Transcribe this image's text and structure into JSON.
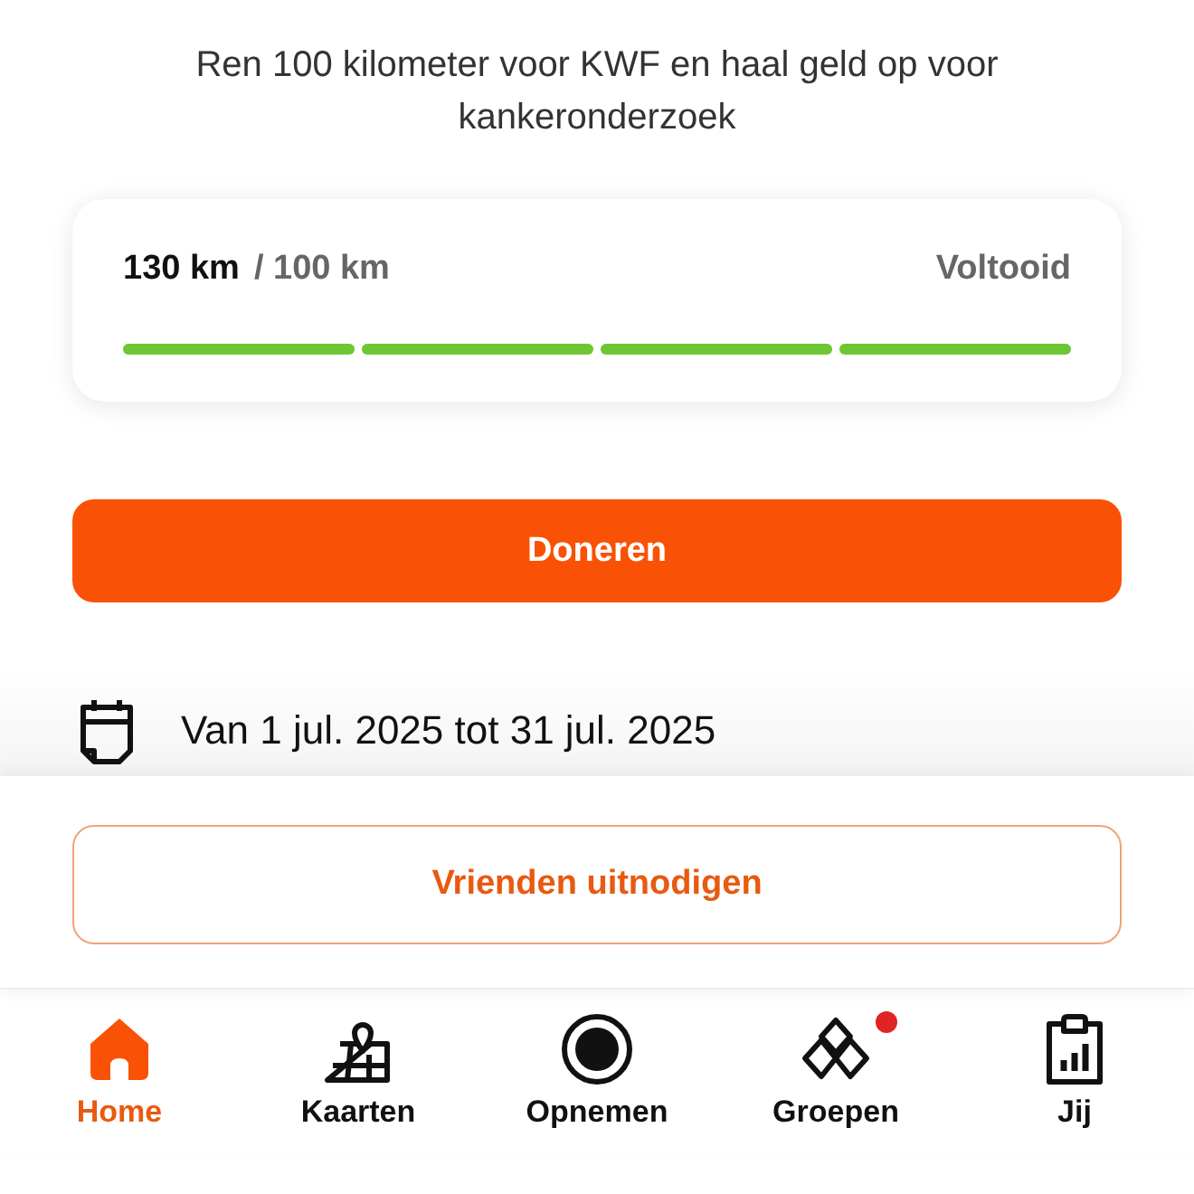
{
  "description": "Ren 100 kilometer voor KWF en haal geld op voor kankeronderzoek",
  "progress": {
    "current": "130 km",
    "goal": "/ 100 km",
    "status": "Voltooid",
    "segments": [
      {
        "level": 1
      },
      {
        "level": 1
      },
      {
        "level": 1
      },
      {
        "level": 1
      }
    ]
  },
  "donate_button": "Doneren",
  "period": "Van 1 jul. 2025 tot 31 jul. 2025",
  "invite_button": "Vrienden uitnodigen",
  "nav": [
    {
      "kind": "home",
      "label": "Home",
      "selected": true,
      "badge": false
    },
    {
      "kind": "maps",
      "label": "Kaarten",
      "selected": false,
      "badge": false
    },
    {
      "kind": "record",
      "label": "Opnemen",
      "selected": false,
      "badge": false
    },
    {
      "kind": "groups",
      "label": "Groepen",
      "selected": false,
      "badge": true
    },
    {
      "kind": "you",
      "label": "Jij",
      "selected": false,
      "badge": false
    }
  ]
}
